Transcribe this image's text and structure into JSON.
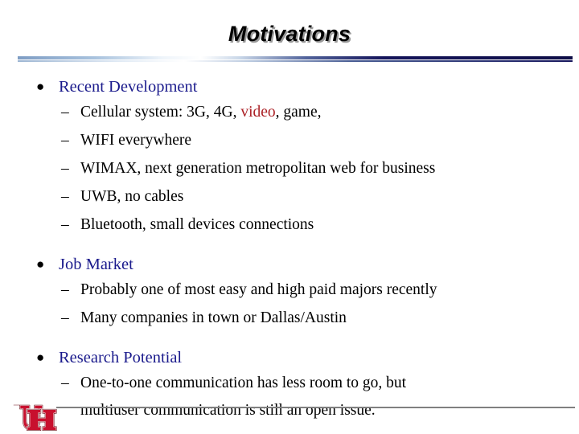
{
  "slide": {
    "title": "Motivations",
    "background_color": "#ffffff",
    "heading_color": "#1a1a8c",
    "body_color": "#000000",
    "accent_color": "#ab1f24",
    "rule_color": "#808080",
    "divider_color": "#14145a"
  },
  "bullets": {
    "bullet_glyph": "●",
    "dash_glyph": "–"
  },
  "groups": [
    {
      "heading": "Recent Development",
      "items": [
        {
          "pre": "Cellular system: 3G, 4G, ",
          "accent": "video",
          "post": ", game,"
        },
        {
          "pre": "WIFI everywhere",
          "accent": "",
          "post": ""
        },
        {
          "pre": "WIMAX, next generation metropolitan web for business",
          "accent": "",
          "post": ""
        },
        {
          "pre": "UWB, no cables",
          "accent": "",
          "post": ""
        },
        {
          "pre": "Bluetooth, small devices connections",
          "accent": "",
          "post": ""
        }
      ]
    },
    {
      "heading": "Job Market",
      "items": [
        {
          "pre": "Probably one of most easy and high paid majors recently",
          "accent": "",
          "post": ""
        },
        {
          "pre": "Many companies  in town or Dallas/Austin",
          "accent": "",
          "post": ""
        }
      ]
    },
    {
      "heading": "Research Potential",
      "items": [
        {
          "pre": "One-to-one communication has less room to go, but",
          "accent": "",
          "post": "",
          "cont": "multiuser communication is still an open issue."
        }
      ]
    }
  ],
  "footer": {
    "logo_name": "university-of-houston-uh-logo",
    "logo_color": "#c8102e",
    "logo_outline": "#ffffff",
    "logo_shadow": "#7d1016"
  }
}
